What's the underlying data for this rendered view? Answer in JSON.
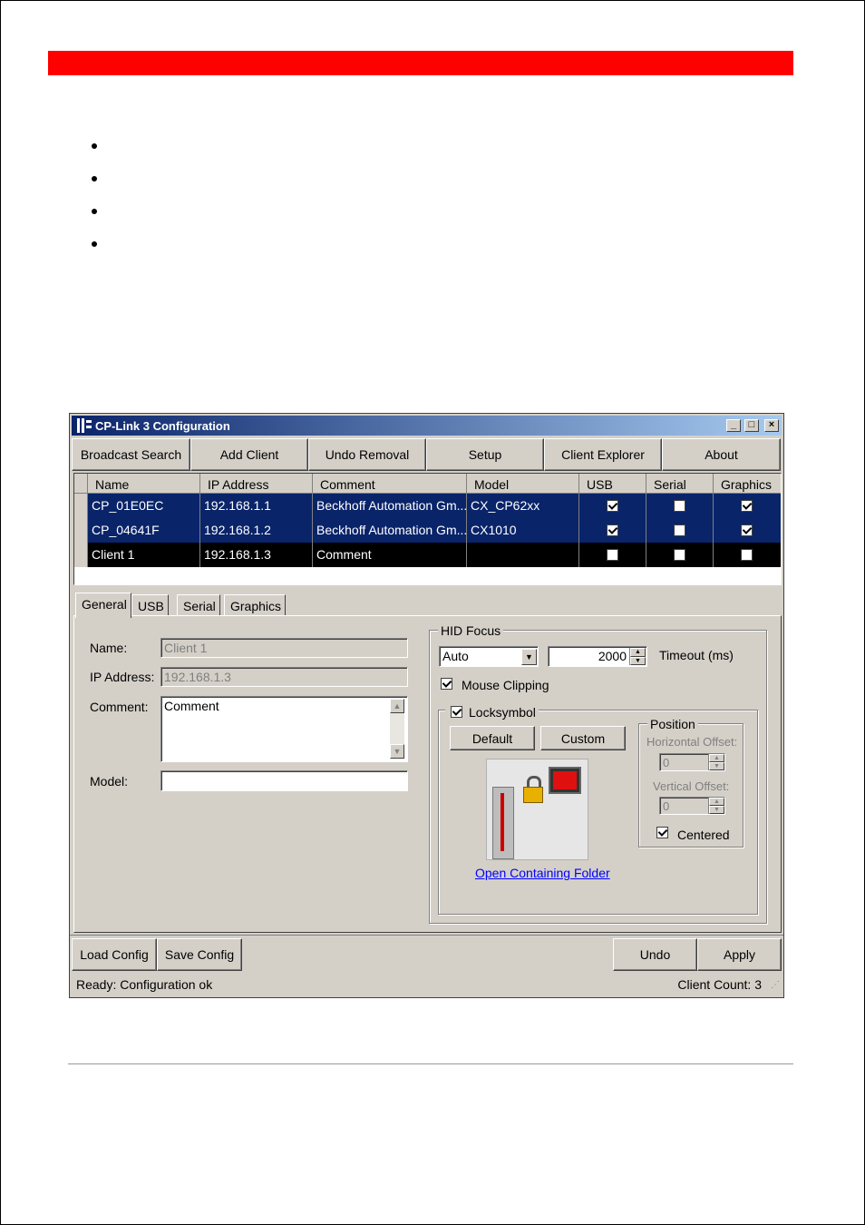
{
  "window": {
    "title": "CP-Link 3 Configuration",
    "title_buttons": [
      "_",
      "□",
      "×"
    ]
  },
  "toolbar": {
    "broadcast_search": "Broadcast Search",
    "add_client": "Add Client",
    "undo_removal": "Undo Removal",
    "setup": "Setup",
    "client_explorer": "Client Explorer",
    "about": "About"
  },
  "grid": {
    "columns": [
      "Name",
      "IP Address",
      "Comment",
      "Model",
      "USB",
      "Serial",
      "Graphics"
    ],
    "rows": [
      {
        "name": "CP_01E0EC",
        "ip": "192.168.1.1",
        "comment": "Beckhoff Automation Gm...",
        "model": "CX_CP62xx",
        "usb": true,
        "serial": false,
        "graphics": true,
        "state": "selected"
      },
      {
        "name": "CP_04641F",
        "ip": "192.168.1.2",
        "comment": "Beckhoff Automation Gm...",
        "model": "CX1010",
        "usb": true,
        "serial": false,
        "graphics": true,
        "state": "selected"
      },
      {
        "name": "Client 1",
        "ip": "192.168.1.3",
        "comment": "Comment",
        "model": "",
        "usb": false,
        "serial": false,
        "graphics": false,
        "state": "current"
      }
    ]
  },
  "tabs": [
    "General",
    "USB",
    "Serial",
    "Graphics"
  ],
  "general": {
    "name_label": "Name:",
    "name_value": "Client 1",
    "ip_label": "IP Address:",
    "ip_value": "192.168.1.3",
    "comment_label": "Comment:",
    "comment_value": "Comment",
    "model_label": "Model:",
    "model_value": ""
  },
  "hid_focus": {
    "title": "HID Focus",
    "mode_value": "Auto",
    "timeout_value": "2000",
    "timeout_label": "Timeout (ms)",
    "mouse_clipping_label": "Mouse Clipping",
    "mouse_clipping": true,
    "locksymbol_label": "Locksymbol",
    "locksymbol": true,
    "default_button": "Default",
    "custom_button": "Custom",
    "open_folder_link": "Open Containing Folder",
    "position": {
      "title": "Position",
      "horizontal_label": "Horizontal Offset:",
      "horizontal_value": "0",
      "vertical_label": "Vertical Offset:",
      "vertical_value": "0",
      "centered_label": "Centered",
      "centered": true
    }
  },
  "bottom": {
    "load_config": "Load Config",
    "save_config": "Save Config",
    "undo": "Undo",
    "apply": "Apply"
  },
  "status": {
    "message": "Ready: Configuration ok",
    "client_count": "Client Count: 3"
  },
  "colors": {
    "red_bar": "#ff0000",
    "selection": "#0a246a",
    "window_face": "#d4d0c8"
  }
}
